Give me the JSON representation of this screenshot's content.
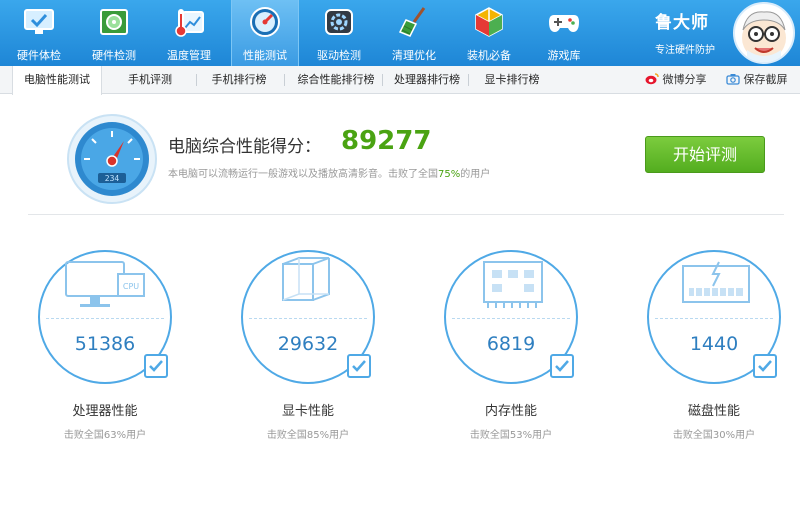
{
  "nav": {
    "items": [
      {
        "label": "硬件体检",
        "icon": "monitor-check-icon"
      },
      {
        "label": "硬件检测",
        "icon": "circuit-board-icon"
      },
      {
        "label": "温度管理",
        "icon": "thermometer-icon"
      },
      {
        "label": "性能测试",
        "icon": "speedometer-icon"
      },
      {
        "label": "驱动检测",
        "icon": "driver-gear-icon"
      },
      {
        "label": "清理优化",
        "icon": "broom-icon"
      },
      {
        "label": "装机必备",
        "icon": "package-box-icon"
      },
      {
        "label": "游戏库",
        "icon": "gamepad-icon"
      }
    ],
    "active_index": 3
  },
  "brand": {
    "name": "鲁大师",
    "slogan": "专注硬件防护"
  },
  "tabs": [
    "电脑性能测试",
    "手机评测",
    "手机排行榜",
    "综合性能排行榜",
    "处理器排行榜",
    "显卡排行榜"
  ],
  "actions": {
    "share": "微博分享",
    "save": "保存截屏"
  },
  "score": {
    "title": "电脑综合性能得分：",
    "value": "89277",
    "desc_prefix": "本电脑可以流畅运行一般游戏以及播放高清影音。击败了全国",
    "desc_pct": "75%",
    "desc_suffix": "的用户",
    "gauge_reading": "234",
    "start_button": "开始评测"
  },
  "cards": [
    {
      "title": "处理器性能",
      "value": "51386",
      "sub": "击败全国63%用户",
      "icon": "cpu-monitor-icon"
    },
    {
      "title": "显卡性能",
      "value": "29632",
      "sub": "击败全国85%用户",
      "icon": "graphics-cube-icon"
    },
    {
      "title": "内存性能",
      "value": "6819",
      "sub": "击败全国53%用户",
      "icon": "memory-chip-icon"
    },
    {
      "title": "磁盘性能",
      "value": "1440",
      "sub": "击败全国30%用户",
      "icon": "hard-disk-icon"
    }
  ],
  "colors": {
    "accent": "#1e86d6",
    "score_green": "#4aa312",
    "ring_blue": "#4fa9e6"
  }
}
